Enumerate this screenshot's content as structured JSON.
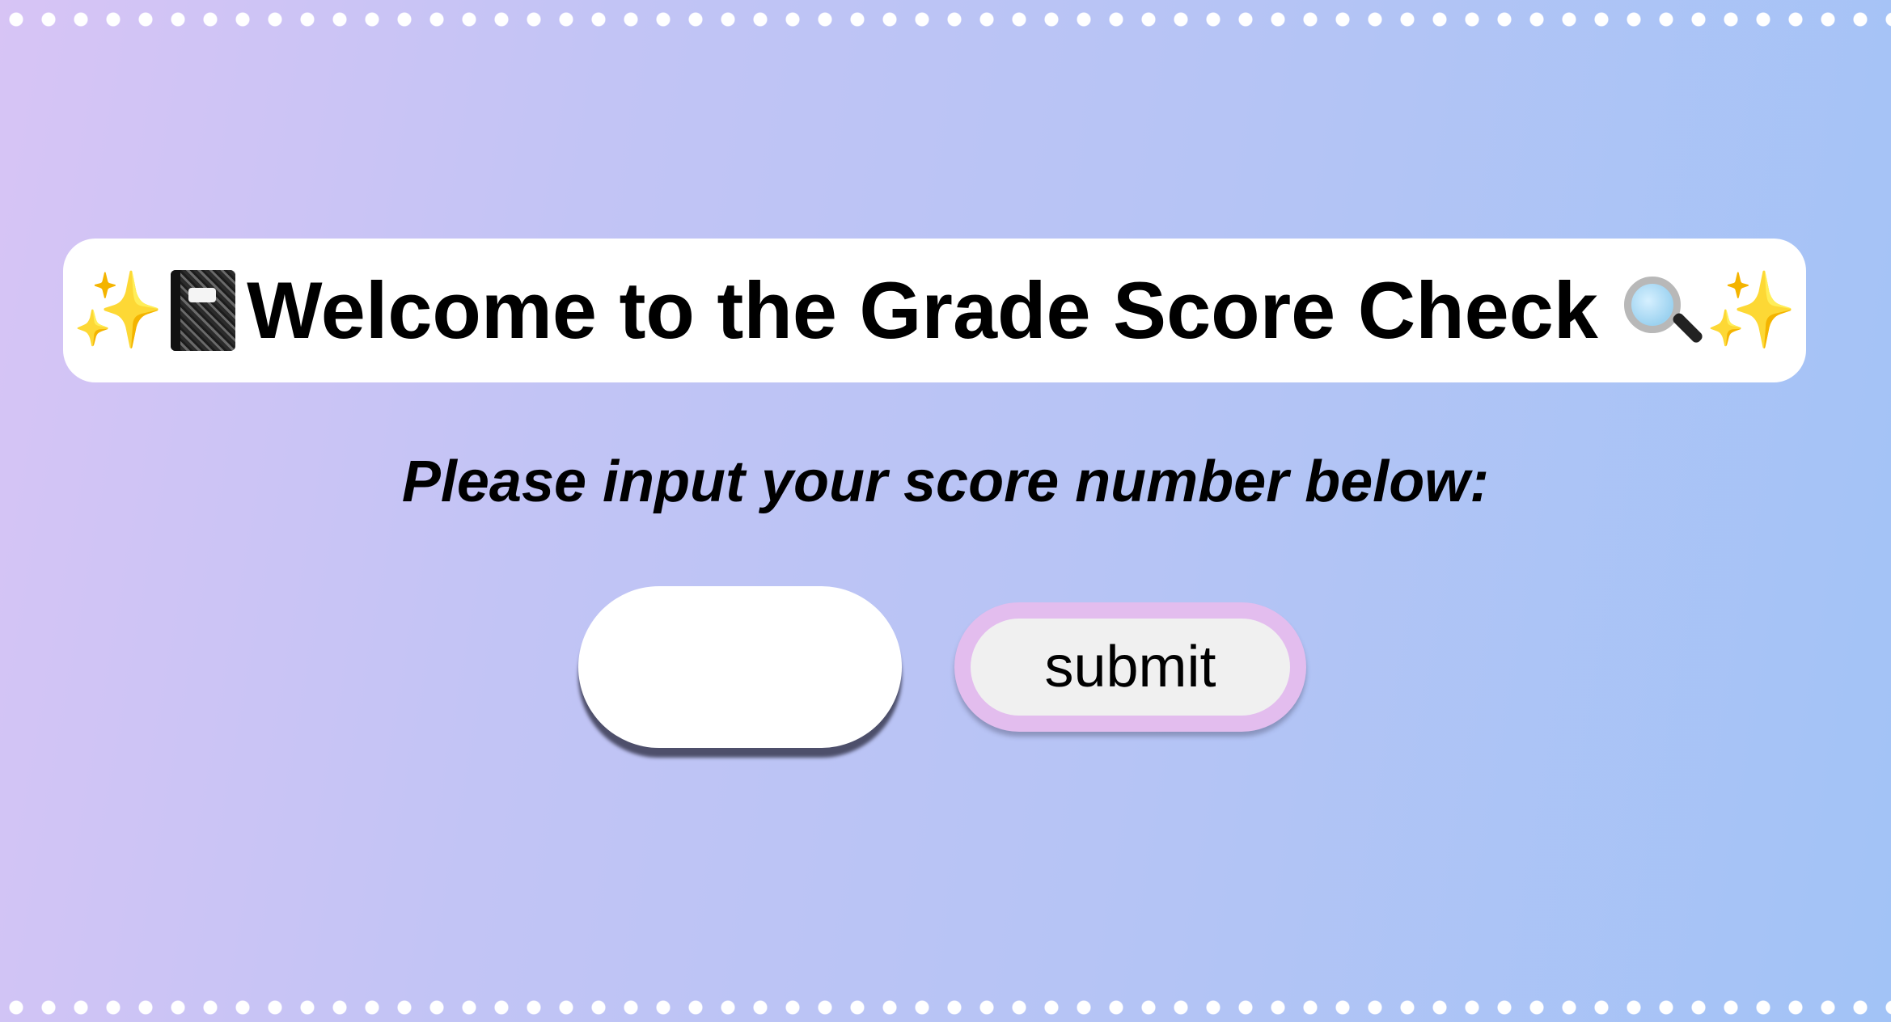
{
  "header": {
    "title": "Welcome to the Grade Score Check",
    "icons": [
      "sparkles-icon",
      "notebook-icon",
      "magnifying-glass-icon",
      "sparkles-icon"
    ]
  },
  "form": {
    "prompt": "Please input your score number below:",
    "score_input": {
      "value": "",
      "placeholder": ""
    },
    "submit_label": "submit"
  },
  "colors": {
    "gradient_start": "#d7c4f5",
    "gradient_end": "#a2c3f6",
    "button_border": "#e3bdee",
    "button_fill": "#f0f0f0",
    "banner_fill": "#ffffff"
  }
}
